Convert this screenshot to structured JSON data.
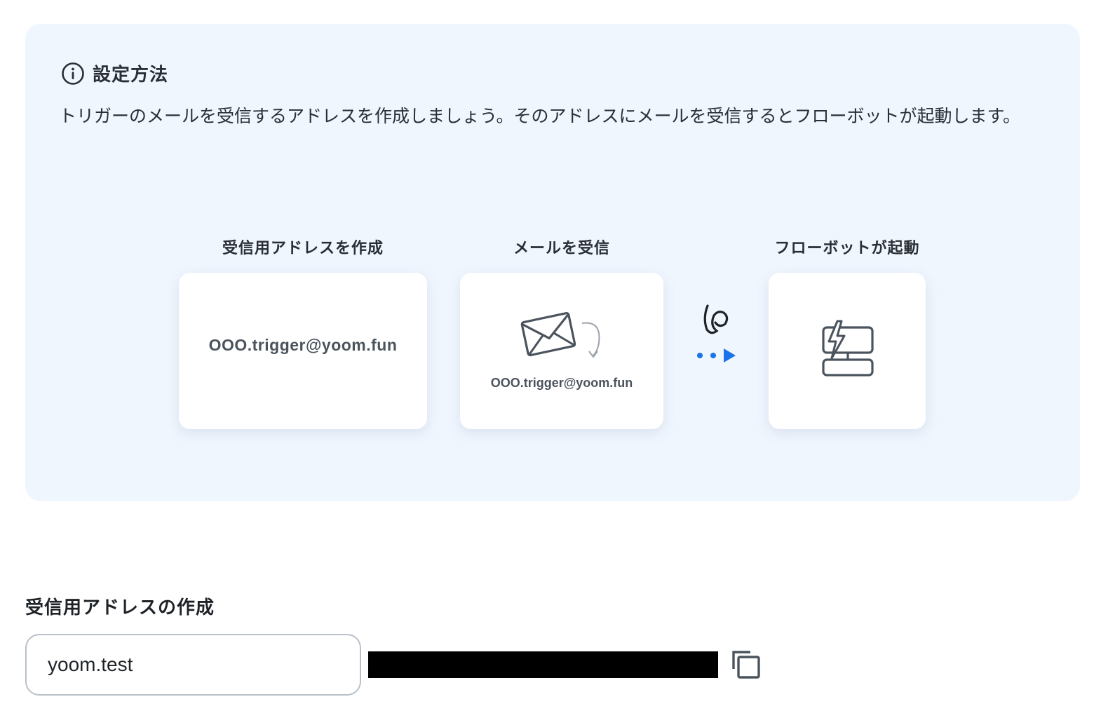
{
  "info": {
    "icon": "info-circle-icon",
    "title": "設定方法",
    "description": "トリガーのメールを受信するアドレスを作成しましょう。そのアドレスにメールを受信するとフローボットが起動します。"
  },
  "steps": [
    {
      "label": "受信用アドレスを作成",
      "icon": "",
      "card_text": "OOO.trigger@yoom.fun"
    },
    {
      "label": "メールを受信",
      "icon": "envelope-icon",
      "card_text": "OOO.trigger@yoom.fun"
    },
    {
      "label": "フローボットが起動",
      "icon": "flowbot-lightning-icon",
      "card_text": ""
    }
  ],
  "connector": {
    "icon": "flow-arrow-icon",
    "accent": "#1a73e8"
  },
  "address_section": {
    "heading": "受信用アドレスの作成",
    "input_value": "yoom.test",
    "copy_icon": "copy-icon"
  },
  "colors": {
    "panel_bg": "#f0f6fe",
    "accent_blue": "#1a73e8",
    "icon_gray": "#4b535d"
  }
}
